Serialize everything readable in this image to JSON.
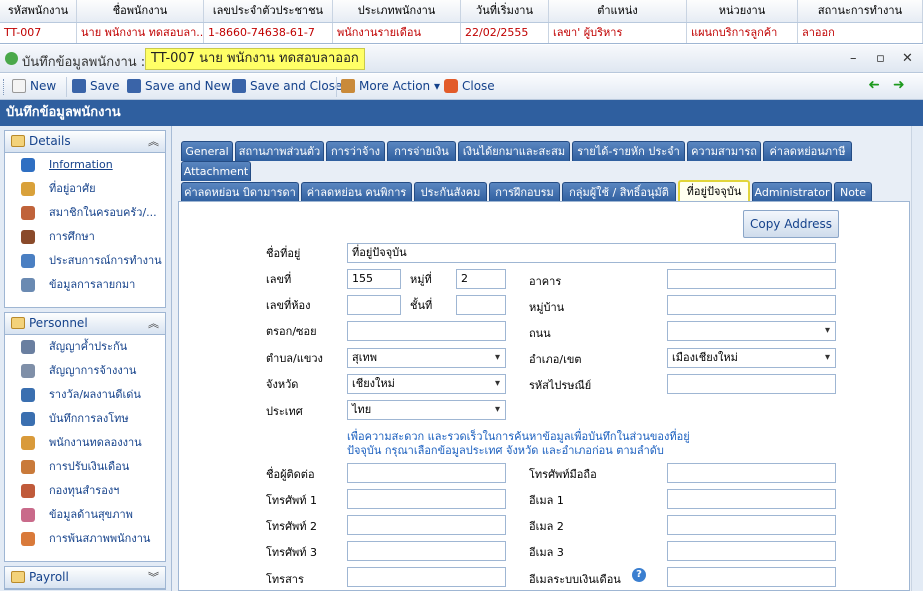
{
  "grid": {
    "headers": [
      "รหัสพนักงาน",
      "ชื่อพนักงาน",
      "เลขประจำตัวประชาชน",
      "ประเภทพนักงาน",
      "วันที่เริ่มงาน",
      "ตำแหน่ง",
      "หน่วยงาน",
      "สถานะการทำงาน"
    ],
    "row": [
      "TT-007",
      "นาย พนักงาน ทดสอบลา...",
      "1-8660-74638-61-7",
      "พนักงานรายเดือน",
      "22/02/2555",
      "เลขา' ผู้บริหาร",
      "แผนกบริการลูกค้า",
      "ลาออก"
    ]
  },
  "window": {
    "title": "บันทึกข้อมูลพนักงาน :",
    "record": "TT-007 นาย พนักงาน ทดสอบลาออก",
    "minimize": "–",
    "maximize": "▫",
    "close": "✕"
  },
  "toolbar": {
    "new": "New",
    "save": "Save",
    "save_new": "Save and New",
    "save_close": "Save and Close",
    "more": "More Action ▾",
    "close": "Close",
    "back_icon": "➜",
    "fwd_icon": "➜"
  },
  "band_title": "บันทึกข้อมูลพนักงาน",
  "sidebar": {
    "details_title": "Details",
    "details_items": [
      "Information",
      "ที่อยู่อาศัย",
      "สมาชิกในครอบครัว/...",
      "การศึกษา",
      "ประสบการณ์การทำงาน",
      "ข้อมูลการลายกมา"
    ],
    "personnel_title": "Personnel",
    "personnel_items": [
      "สัญญาค้ำประกัน",
      "สัญญาการจ้างงาน",
      "รางวัล/ผลงานดีเด่น",
      "บันทึกการลงโทษ",
      "พนักงานทดลองงาน",
      "การปรับเงินเดือน",
      "กองทุนสำรองฯ",
      "ข้อมูลด้านสุขภาพ",
      "การพ้นสภาพพนักงาน"
    ],
    "payroll_title": "Payroll"
  },
  "tabs_row1": [
    "General",
    "สถานภาพส่วนตัว",
    "การว่าจ้าง",
    "การจ่ายเงิน",
    "เงินได้ยกมาและสะสม",
    "รายได้-รายหัก ประจำ",
    "ความสามารถ",
    "ค่าลดหย่อนภาษี",
    "Attachment"
  ],
  "tabs_row2": [
    "ค่าลดหย่อน บิดามารดา",
    "ค่าลดหย่อน คนพิการ",
    "ประกันสังคม",
    "การฝึกอบรม",
    "กลุ่มผู้ใช้ / สิทธิ์อนุมัติ",
    "ที่อยู่ปัจจุบัน",
    "Administrator",
    "Note"
  ],
  "form": {
    "copy_button": "Copy Address",
    "address_name_label": "ชื่อที่อยู่",
    "address_name_value": "ที่อยู่ปัจจุบัน",
    "house_no_label": "เลขที่",
    "house_no_value": "155",
    "moo_label": "หมู่ที่",
    "moo_value": "2",
    "building_label": "อาคาร",
    "room_label": "เลขที่ห้อง",
    "floor_label": "ชั้นที่",
    "village_label": "หมู่บ้าน",
    "soi_label": "ตรอก/ซอย",
    "road_label": "ถนน",
    "subdistrict_label": "ตำบล/แขวง",
    "subdistrict_value": "สุเทพ",
    "district_label": "อำเภอ/เขต",
    "district_value": "เมืองเชียงใหม่",
    "province_label": "จังหวัด",
    "province_value": "เชียงใหม่",
    "postcode_label": "รหัสไปรษณีย์",
    "country_label": "ประเทศ",
    "country_value": "ไทย",
    "note": "เพื่อความสะดวก และรวดเร็วในการค้นหาข้อมูลเพื่อบันทึกในส่วนของที่อยู่ปัจจุบัน กรุณาเลือกข้อมูลประเทศ จังหวัด และอำเภอก่อน ตามลำดับ",
    "contact_label": "ชื่อผู้ติดต่อ",
    "mobile_label": "โทรศัพท์มือถือ",
    "phone1_label": "โทรศัพท์ 1",
    "email1_label": "อีเมล 1",
    "phone2_label": "โทรศัพท์ 2",
    "email2_label": "อีเมล 2",
    "phone3_label": "โทรศัพท์ 3",
    "email3_label": "อีเมล 3",
    "fax_label": "โทรสาร",
    "payroll_email_label": "อีเมลระบบเงินเดือน",
    "help": "?"
  },
  "colors": {
    "band": "#2f5f9f",
    "tab": "#2f5f9f",
    "highlight": "#ffff66",
    "row_text": "#c00000"
  }
}
